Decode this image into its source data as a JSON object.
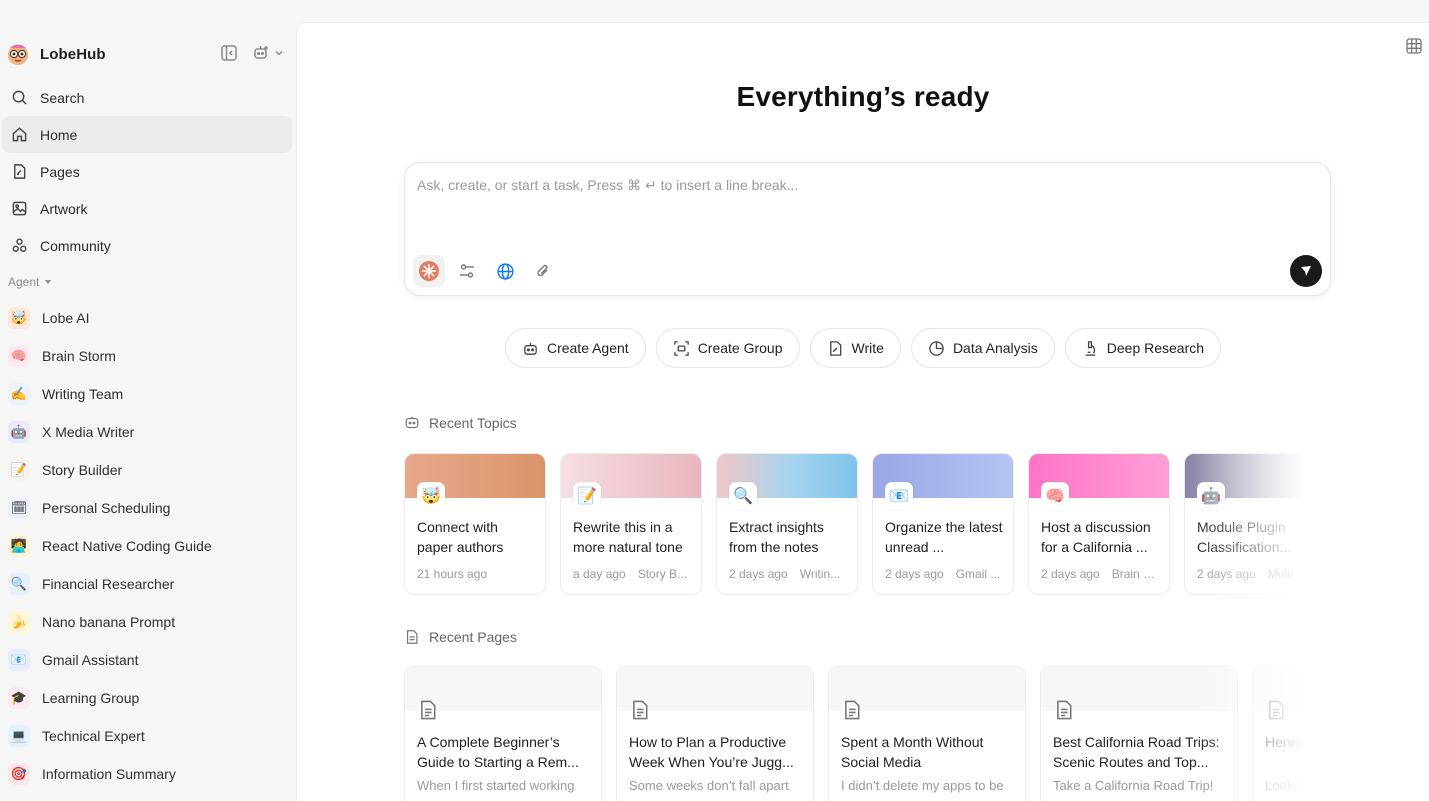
{
  "app": {
    "name": "LobeHub"
  },
  "nav": [
    {
      "label": "Search",
      "icon": "search-icon"
    },
    {
      "label": "Home",
      "icon": "home-icon",
      "active": true
    },
    {
      "label": "Pages",
      "icon": "pages-icon"
    },
    {
      "label": "Artwork",
      "icon": "image-icon"
    },
    {
      "label": "Community",
      "icon": "community-icon"
    }
  ],
  "agents_section": {
    "label": "Agent"
  },
  "agents": [
    {
      "label": "Lobe AI",
      "emoji": "🤯",
      "bg": "#fde7d8"
    },
    {
      "label": "Brain Storm",
      "emoji": "🧠",
      "bg": "#fde9ee"
    },
    {
      "label": "Writing Team",
      "emoji": "✍️",
      "bg": "#eef1fb"
    },
    {
      "label": "X Media Writer",
      "emoji": "🤖",
      "bg": "#ece9fb"
    },
    {
      "label": "Story Builder",
      "emoji": "📝",
      "bg": "#fdf0e6"
    },
    {
      "label": "Personal Scheduling",
      "emoji": "🗓",
      "bg": "#eaf1fb"
    },
    {
      "label": "React Native Coding Guide",
      "emoji": "🧑‍💻",
      "bg": "#fff3d9"
    },
    {
      "label": "Financial Researcher",
      "emoji": "🔍",
      "bg": "#e7f0fd"
    },
    {
      "label": "Nano banana Prompt",
      "emoji": "🍌",
      "bg": "#fff6d6"
    },
    {
      "label": "Gmail Assistant",
      "emoji": "📧",
      "bg": "#e8ecfc"
    },
    {
      "label": "Learning Group",
      "emoji": "🎓",
      "bg": "#fde9ee"
    },
    {
      "label": "Technical Expert",
      "emoji": "💻",
      "bg": "#e5f2fd"
    },
    {
      "label": "Information Summary",
      "emoji": "🎯",
      "bg": "#fde7ea"
    }
  ],
  "main": {
    "title": "Everything’s ready",
    "composer": {
      "placeholder": "Ask, create, or start a task, Press ⌘ ↵ to insert a line break..."
    },
    "quick_actions": [
      {
        "label": "Create Agent",
        "icon": "robot-icon"
      },
      {
        "label": "Create Group",
        "icon": "group-icon"
      },
      {
        "label": "Write",
        "icon": "pen-icon"
      },
      {
        "label": "Data Analysis",
        "icon": "pie-chart-icon"
      },
      {
        "label": "Deep Research",
        "icon": "microscope-icon"
      }
    ],
    "recent_topics_title": "Recent Topics",
    "recent_topics": [
      {
        "title": "Connect with paper authors",
        "time": "21 hours ago",
        "agent": "",
        "emoji": "🤯",
        "gradient": "linear-gradient(90deg,#e8a98c,#d9956a)"
      },
      {
        "title": "Rewrite this in a more natural tone",
        "time": "a day ago",
        "agent": "Story B...",
        "emoji": "📝",
        "gradient": "linear-gradient(90deg,#f5dfe2,#e9b6bf)"
      },
      {
        "title": "Extract insights from the notes",
        "time": "2 days ago",
        "agent": "Writin...",
        "emoji": "🔍",
        "gradient": "linear-gradient(90deg,#f1c6c6,#a9d4ee,#7fc4ea)"
      },
      {
        "title": "Organize the latest unread ...",
        "time": "2 days ago",
        "agent": "Gmail ...",
        "emoji": "📧",
        "gradient": "linear-gradient(90deg,#9aa6e6,#b6c4f2)"
      },
      {
        "title": "Host a discussion for a California ...",
        "time": "2 days ago",
        "agent": "Brain S...",
        "emoji": "🧠",
        "gradient": "linear-gradient(90deg,#ff74c6,#ff9fd7)"
      },
      {
        "title": "Module Plugin Classification...",
        "time": "2 days ago",
        "agent": "Multi",
        "emoji": "🤖",
        "gradient": "linear-gradient(90deg,#8b85a8,#c9c6d6)"
      }
    ],
    "recent_pages_title": "Recent Pages",
    "recent_pages": [
      {
        "title": "A Complete Beginner’s Guide to Starting a Rem...",
        "excerpt": "When I first started working"
      },
      {
        "title": "How to Plan a Productive Week When You’re Jugg...",
        "excerpt": "Some weeks don’t fall apart"
      },
      {
        "title": "Spent a Month Without Social Media",
        "excerpt": "I didn’t delete my apps to be"
      },
      {
        "title": "Best California Road Trips: Scenic Routes and Top...",
        "excerpt": "Take a California Road Trip!"
      },
      {
        "title": "Henry gu Story ver",
        "excerpt": "Looking"
      }
    ]
  }
}
